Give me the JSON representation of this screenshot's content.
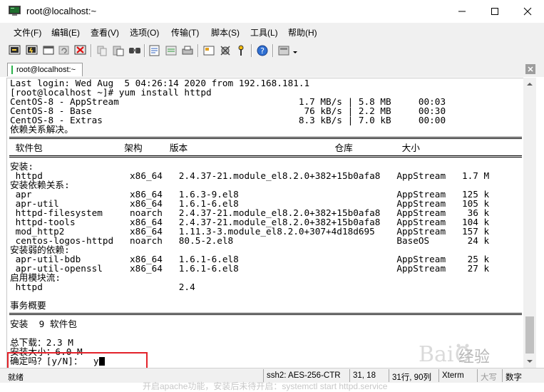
{
  "window": {
    "title": "root@localhost:~"
  },
  "menu": [
    "文件(F)",
    "编辑(E)",
    "查看(V)",
    "选项(O)",
    "传输(T)",
    "脚本(S)",
    "工具(L)",
    "帮助(H)"
  ],
  "tab": {
    "label": "root@localhost:~"
  },
  "terminal": {
    "lines": [
      "Last login: Wed Aug  5 04:26:14 2020 from 192.168.181.1",
      "[root@localhost ~]# yum install httpd",
      "CentOS-8 - AppStream                                 1.7 MB/s | 5.8 MB     00:03",
      "CentOS-8 - Base                                       76 kB/s | 2.2 MB     00:30",
      "CentOS-8 - Extras                                    8.3 kB/s | 7.0 kB     00:00",
      "依赖关系解决。",
      "",
      " 软件包               架构     版本                           仓库         大小",
      "",
      "安装:",
      " httpd                x86_64   2.4.37-21.module_el8.2.0+382+15b0afa8   AppStream   1.7 M",
      "安装依赖关系:",
      " apr                  x86_64   1.6.3-9.el8                             AppStream   125 k",
      " apr-util             x86_64   1.6.1-6.el8                             AppStream   105 k",
      " httpd-filesystem     noarch   2.4.37-21.module_el8.2.0+382+15b0afa8   AppStream    36 k",
      " httpd-tools          x86_64   2.4.37-21.module_el8.2.0+382+15b0afa8   AppStream   104 k",
      " mod_http2            x86_64   1.11.3-3.module_el8.2.0+307+4d18d695    AppStream   157 k",
      " centos-logos-httpd   noarch   80.5-2.el8                              BaseOS       24 k",
      "安装弱的依赖:",
      " apr-util-bdb         x86_64   1.6.1-6.el8                             AppStream    25 k",
      " apr-util-openssl     x86_64   1.6.1-6.el8                             AppStream    27 k",
      "启用模块流:",
      " httpd                         2.4",
      "",
      "事务概要",
      "",
      "安装  9 软件包",
      "",
      "总下载：2.3 M",
      "安装大小：6.0 M",
      "确定吗？[y/N]：  y"
    ]
  },
  "status": {
    "text": "就绪",
    "cipher": "ssh2: AES-256-CTR",
    "position": "31,  18",
    "size": "31行, 90列",
    "term": "Xterm",
    "caps": "大写",
    "num": "数字"
  },
  "caption": "开启apache功能，安装后未待开启：systemctl start httpd.service",
  "watermark": "经验"
}
